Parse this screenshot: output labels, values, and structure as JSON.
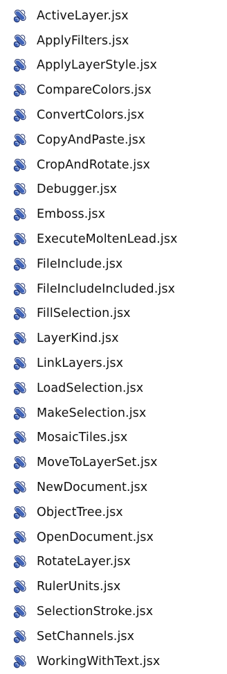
{
  "files": [
    {
      "name": "ActiveLayer.jsx",
      "icon": "script-scroll-icon"
    },
    {
      "name": "ApplyFilters.jsx",
      "icon": "script-scroll-icon"
    },
    {
      "name": "ApplyLayerStyle.jsx",
      "icon": "script-scroll-icon"
    },
    {
      "name": "CompareColors.jsx",
      "icon": "script-scroll-icon"
    },
    {
      "name": "ConvertColors.jsx",
      "icon": "script-scroll-icon"
    },
    {
      "name": "CopyAndPaste.jsx",
      "icon": "script-scroll-icon"
    },
    {
      "name": "CropAndRotate.jsx",
      "icon": "script-scroll-icon"
    },
    {
      "name": "Debugger.jsx",
      "icon": "script-scroll-icon"
    },
    {
      "name": "Emboss.jsx",
      "icon": "script-scroll-icon"
    },
    {
      "name": "ExecuteMoltenLead.jsx",
      "icon": "script-scroll-icon"
    },
    {
      "name": "FileInclude.jsx",
      "icon": "script-scroll-icon"
    },
    {
      "name": "FileIncludeIncluded.jsx",
      "icon": "script-scroll-icon"
    },
    {
      "name": "FillSelection.jsx",
      "icon": "script-scroll-icon"
    },
    {
      "name": "LayerKind.jsx",
      "icon": "script-scroll-icon"
    },
    {
      "name": "LinkLayers.jsx",
      "icon": "script-scroll-icon"
    },
    {
      "name": "LoadSelection.jsx",
      "icon": "script-scroll-icon"
    },
    {
      "name": "MakeSelection.jsx",
      "icon": "script-scroll-icon"
    },
    {
      "name": "MosaicTiles.jsx",
      "icon": "script-scroll-icon"
    },
    {
      "name": "MoveToLayerSet.jsx",
      "icon": "script-scroll-icon"
    },
    {
      "name": "NewDocument.jsx",
      "icon": "script-scroll-icon"
    },
    {
      "name": "ObjectTree.jsx",
      "icon": "script-scroll-icon"
    },
    {
      "name": "OpenDocument.jsx",
      "icon": "script-scroll-icon"
    },
    {
      "name": "RotateLayer.jsx",
      "icon": "script-scroll-icon"
    },
    {
      "name": "RulerUnits.jsx",
      "icon": "script-scroll-icon"
    },
    {
      "name": "SelectionStroke.jsx",
      "icon": "script-scroll-icon"
    },
    {
      "name": "SetChannels.jsx",
      "icon": "script-scroll-icon"
    },
    {
      "name": "WorkingWithText.jsx",
      "icon": "script-scroll-icon"
    }
  ],
  "colors": {
    "background": "#ffffff",
    "text": "#111111",
    "icon_scroll_blue": "#3f63b8",
    "icon_scroll_light": "#dfe7f7",
    "icon_outline": "#1e2f66"
  }
}
